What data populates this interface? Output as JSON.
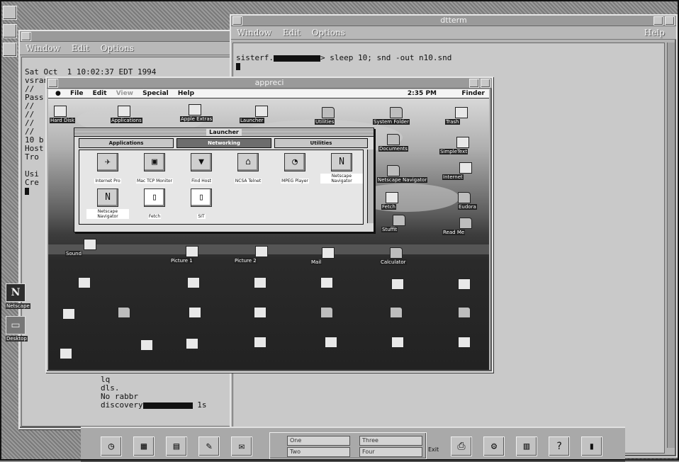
{
  "back_terminal": {
    "window_title_fragment": "Window  Edit  Option",
    "menu": [
      "Window",
      "Edit",
      "Options"
    ],
    "lines": [
      "Sat Oct  1 10:02:37 EDT 1994",
      "vsrand[REDACTED] /usr/local/bin/aroot",
      "//",
      "Pass",
      "//",
      "//",
      "//",
      "//",
      "10 b",
      "Host",
      "Tro",
      "",
      "Usi",
      "Cre"
    ],
    "bottom_lines": [
      "lq",
      "dls.",
      "No rabbr",
      "discovery[REDACTED] 1s"
    ]
  },
  "dtterm": {
    "title": "dtterm",
    "menu": [
      "Window",
      "Edit",
      "Options"
    ],
    "help_label": "Help",
    "command_prefix": "sisterf.",
    "command_suffix": "> sleep 10; snd -out n10.snd"
  },
  "mac_window": {
    "title": "appreci",
    "menu": [
      "File",
      "Edit",
      "View",
      "Special",
      "Help"
    ],
    "clock": "2:35 PM",
    "finder_label": "Finder",
    "desktop_labels": [
      "Hard Disk",
      "Applications",
      "Apple Extras",
      "Launcher",
      "Utilities",
      "System Folder",
      "Trash",
      "Documents",
      "SimpleText",
      "Netscape Navigator",
      "Internet",
      "Fetch",
      "Eudora",
      "Stuffit",
      "Read Me",
      "Sound",
      "Picture 1",
      "Picture 2",
      "Mail",
      "Calculator"
    ]
  },
  "launcher": {
    "title": "Launcher",
    "tabs": [
      "Applications",
      "Networking",
      "Utilities"
    ],
    "active_tab": "Networking",
    "items": [
      {
        "label": "Internet Pro",
        "icon": "internet-icon",
        "glyph": "✈"
      },
      {
        "label": "Mac TCP Monitor",
        "icon": "monitor-icon",
        "glyph": "▣"
      },
      {
        "label": "Find Host",
        "icon": "triangle-icon",
        "glyph": "▼"
      },
      {
        "label": "NCSA Telnet",
        "icon": "telnet-icon",
        "glyph": "⌂"
      },
      {
        "label": "MPEG Player",
        "icon": "player-icon",
        "glyph": "◔"
      },
      {
        "label": "Netscape Navigator",
        "icon": "netscape-icon",
        "glyph": "N"
      },
      {
        "label": "Netscape Navigator",
        "icon": "netscape-icon",
        "glyph": "N"
      },
      {
        "label": "Fetch",
        "icon": "document-icon",
        "glyph": "▯"
      },
      {
        "label": "SIT",
        "icon": "document-icon",
        "glyph": "▯"
      }
    ]
  },
  "side_apps": [
    {
      "label": "Netscape",
      "glyph": "N"
    },
    {
      "label": "Desktop",
      "glyph": "▭"
    }
  ],
  "front_panel": {
    "workspaces": [
      "One",
      "Three",
      "Two",
      "Four"
    ],
    "exit_label": "Exit",
    "buttons": [
      {
        "name": "clock-icon",
        "glyph": "◷"
      },
      {
        "name": "calendar-icon",
        "glyph": "▦"
      },
      {
        "name": "file-manager-icon",
        "glyph": "▤"
      },
      {
        "name": "editor-icon",
        "glyph": "✎"
      },
      {
        "name": "mailer-icon",
        "glyph": "✉"
      },
      {
        "name": "printer-icon",
        "glyph": "⎙"
      },
      {
        "name": "style-manager-icon",
        "glyph": "⚙"
      },
      {
        "name": "app-manager-icon",
        "glyph": "▥"
      },
      {
        "name": "help-icon",
        "glyph": "?"
      },
      {
        "name": "trash-icon",
        "glyph": "▮"
      }
    ]
  }
}
